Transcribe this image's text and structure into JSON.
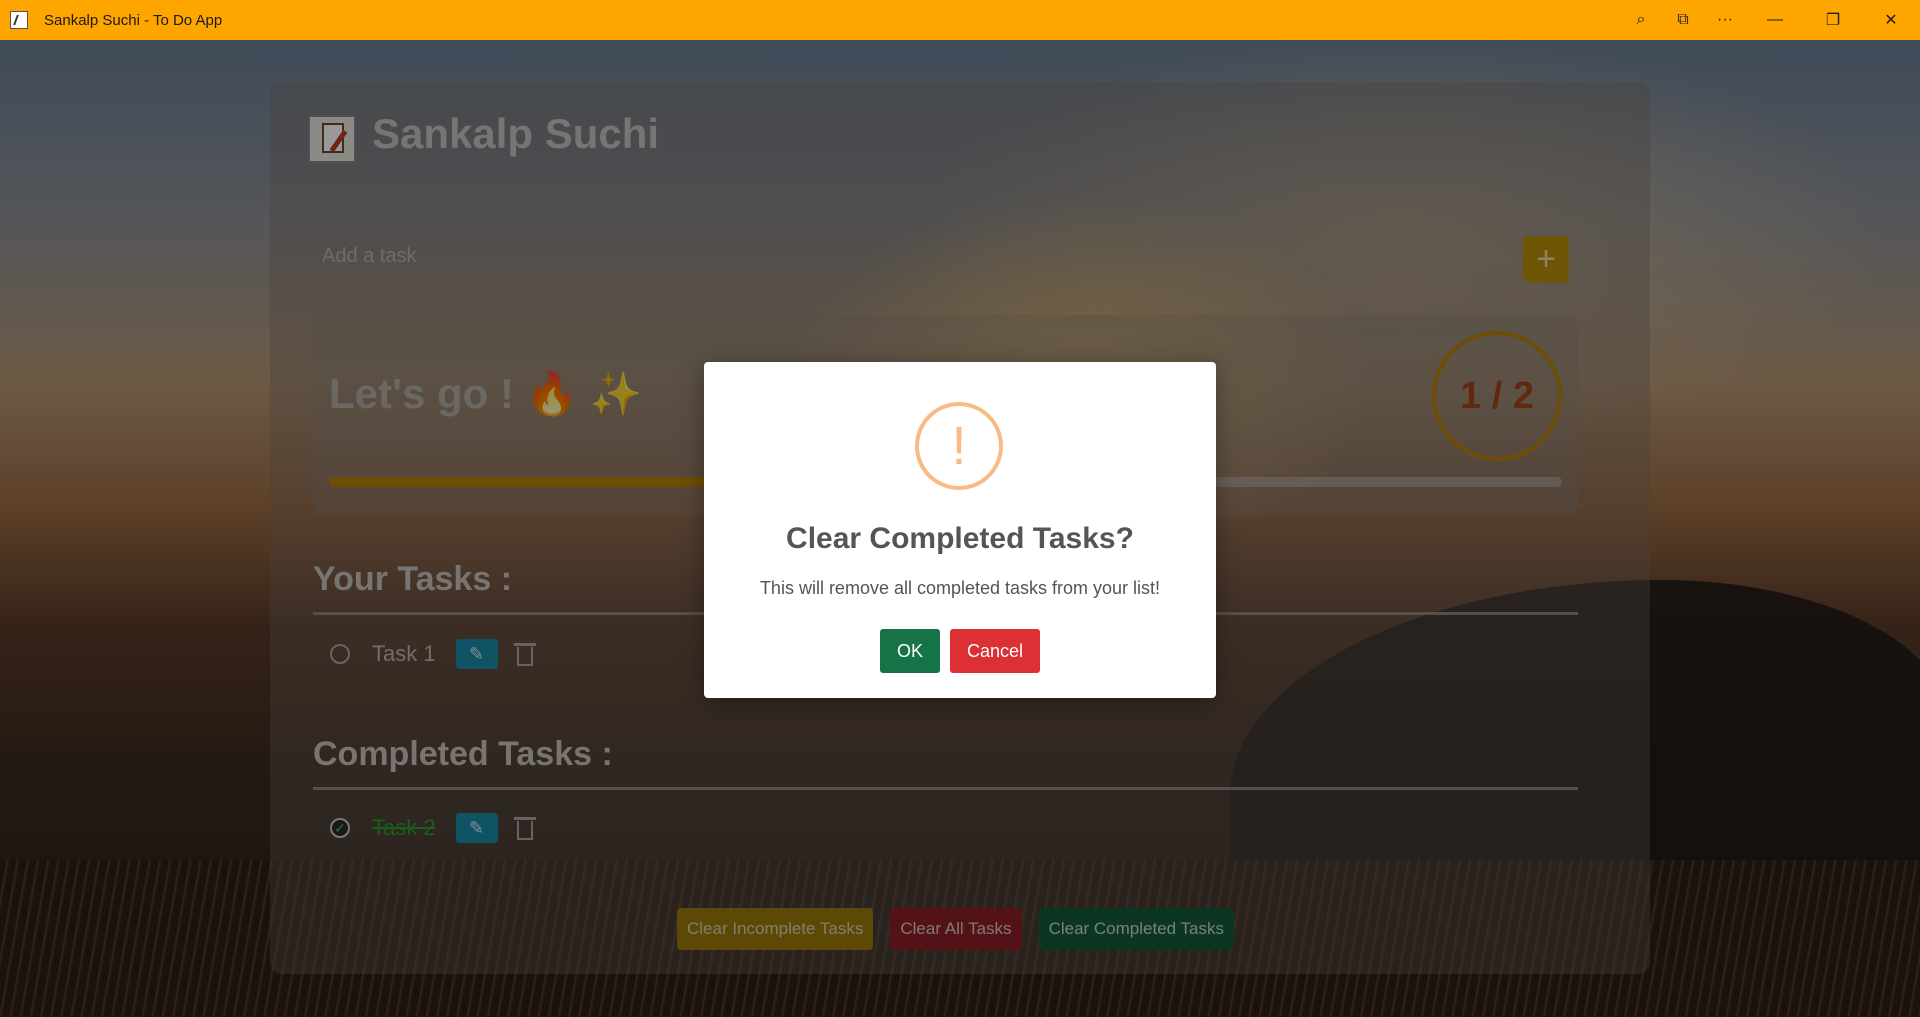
{
  "window": {
    "title": "Sankalp Suchi - To Do App",
    "controls": [
      "zoom-icon",
      "devices-icon",
      "more-icon",
      "minimize-icon",
      "restore-icon",
      "close-icon"
    ],
    "more_label": "···",
    "minimize_label": "—",
    "restore_label": "❐",
    "close_label": "✕",
    "zoom_label": "⌕",
    "devices_label": "⧉"
  },
  "app": {
    "title": "Sankalp Suchi",
    "input_placeholder": "Add a task",
    "add_label": "+"
  },
  "progress": {
    "message": "Let's go ! 🔥 ✨",
    "completed": 1,
    "total": 2,
    "counter_text": "1 / 2",
    "fill_fraction": 0.5
  },
  "sections": {
    "your_tasks_title": "Your Tasks :",
    "completed_tasks_title": "Completed Tasks :"
  },
  "tasks": [
    {
      "text": "Task 1",
      "completed": false
    }
  ],
  "completed_tasks": [
    {
      "text": "Task 2",
      "completed": true
    }
  ],
  "buttons": {
    "edit_icon": "✎",
    "clear_incomplete": "Clear Incomplete Tasks",
    "clear_all": "Clear All Tasks",
    "clear_completed": "Clear Completed Tasks"
  },
  "modal": {
    "icon": "!",
    "title": "Clear Completed Tasks?",
    "text": "This will remove all completed tasks from your list!",
    "ok_label": "OK",
    "cancel_label": "Cancel"
  },
  "colors": {
    "titlebar": "#ffa500",
    "accent": "#b7820a",
    "ok": "#157347",
    "cancel": "#dc3035",
    "edit": "#1a8aa8",
    "warning_icon": "#f8bb86"
  }
}
